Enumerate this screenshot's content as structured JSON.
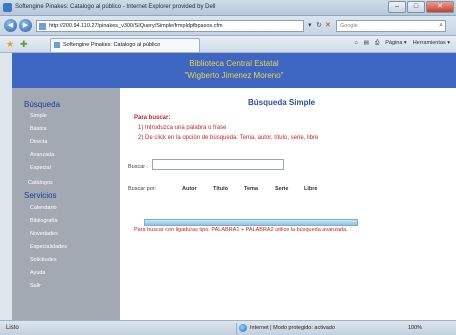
{
  "window": {
    "title": "Softengine Pinakes: Catalogo al público - Internet Explorer provided by Dell",
    "min": "–",
    "max": "□",
    "close": "✕"
  },
  "addressbar": {
    "url": "http://200.94.110.27/pinakes_v300/SIQuery/Simple/frmpldpfbpasos.cfm",
    "search_placeholder": "Google"
  },
  "tab": {
    "label": "Softengine Pinakes: Catalogo al público"
  },
  "toolbar": {
    "home": "⌂",
    "feeds": "▤",
    "print": "⎙",
    "page": "Página ▾",
    "tools": "Herramientas ▾"
  },
  "banner": {
    "line1": "Biblioteca Central Estatal",
    "line2": "\"Wigberto Jimenez Moreno\""
  },
  "sidebar": {
    "section1": "Búsqueda",
    "search_items": [
      "Simple",
      "Básica",
      "Directa",
      "Avanzada",
      "Especial"
    ],
    "catalogs": "Catálogos",
    "section2": "Servicios",
    "service_items": [
      "Calendario",
      "Bibliografía",
      "Novedades",
      "Especialidades",
      "Solicitudes",
      "Ayuda",
      "Salir"
    ]
  },
  "main": {
    "heading": "Búsqueda Simple",
    "howto_title": "Para buscar:",
    "steps": [
      "1) Introduzca una palabra o frase",
      "2) De click en la opción de búsqueda: Tema, autor, título, serie, libre"
    ],
    "search_label": "Buscar :",
    "search_value": "",
    "by_label": "Buscar por:",
    "options": [
      "Autor",
      "Título",
      "Tema",
      "Serie",
      "Libre"
    ],
    "note": "Para buscar con ligaduras tipo: PALABRA1 + PALABRA2 utilice la búsqueda avanzada."
  },
  "statusbar": {
    "status": "Listo",
    "zone": "Internet | Modo protegido: activado",
    "zoom": "100%"
  }
}
